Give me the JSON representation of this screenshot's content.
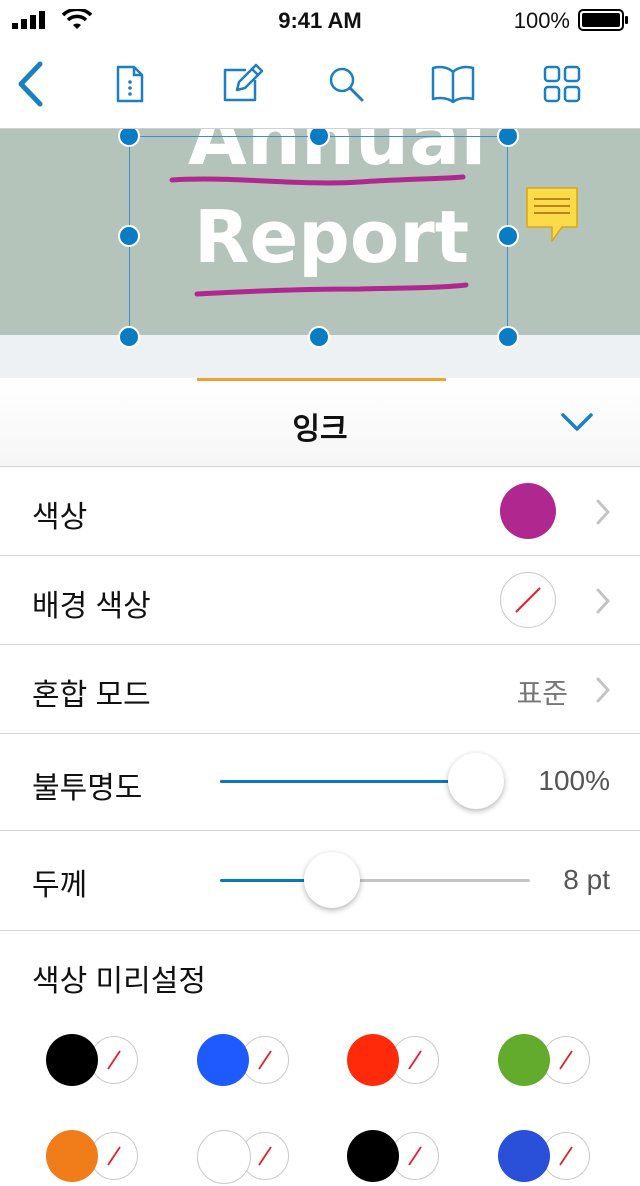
{
  "status_bar": {
    "time": "9:41 AM",
    "battery": "100%"
  },
  "toolbar": {
    "icons": [
      "back-chevron-icon",
      "page-info-icon",
      "edit-icon",
      "search-icon",
      "bookmarks-book-icon",
      "thumbnails-grid-icon"
    ],
    "accent_color": "#1b7fc3"
  },
  "document": {
    "heading_line1": "Annual",
    "heading_line2": "Report",
    "ink_color": "#b0278f",
    "background_color": "#b4c4bb"
  },
  "panel": {
    "title": "잉크",
    "rows": {
      "color": {
        "label": "색상",
        "value_color": "#b0278f"
      },
      "background_color": {
        "label": "배경 색상",
        "value": "none"
      },
      "blend_mode": {
        "label": "혼합 모드",
        "value": "표준"
      },
      "opacity": {
        "label": "불투명도",
        "value": "100%",
        "fraction": 1.0
      },
      "thickness": {
        "label": "두께",
        "value": "8 pt",
        "fraction": 0.36
      },
      "presets": {
        "label": "색상 미리설정"
      }
    },
    "presets": [
      {
        "color": "#000000"
      },
      {
        "color": "#1f5aff"
      },
      {
        "color": "#ff2a0a"
      },
      {
        "color": "#63ab2c"
      }
    ],
    "presets_partial": [
      {
        "color": "#f07d1a"
      },
      {
        "color": "#ffffff"
      },
      {
        "color": "#000000"
      },
      {
        "color": "#2a4fd8"
      }
    ]
  }
}
